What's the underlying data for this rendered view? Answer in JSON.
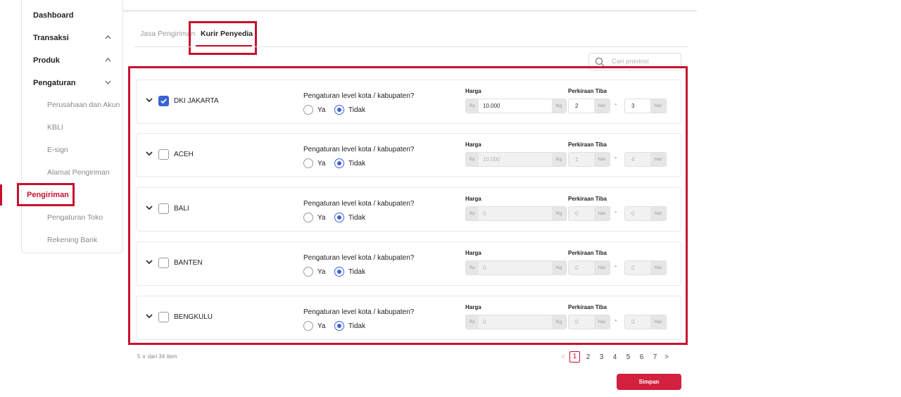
{
  "sidebar": {
    "dashboard": "Dashboard",
    "transaksi": "Transaksi",
    "produk": "Produk",
    "pengaturan": "Pengaturan",
    "sub_items": [
      "Perusahaan dan Akun",
      "KBLI",
      "E-sign",
      "Alamat Pengiriman",
      "Pengiriman",
      "Pengaturan Toko",
      "Rekening Bank"
    ],
    "active_item": "Pengiriman"
  },
  "tabs": [
    "Jasa Pengiriman",
    "Kurir Penyedia"
  ],
  "active_tab": "Kurir Penyedia",
  "search": {
    "placeholder": "Cari provinsi"
  },
  "labels": {
    "question": "Pengaturan level kota / kabupaten?",
    "yes": "Ya",
    "no": "Tidak",
    "price": "Harga",
    "eta": "Perkiraan Tiba",
    "currency_prefix": "Rp",
    "unit_suffix": "/Kg",
    "day_suffix": "Hari"
  },
  "provinces": [
    {
      "name": "DKI JAKARTA",
      "checked": true,
      "city_level": false,
      "price": "10.000",
      "eta_min": "2",
      "eta_max": "3"
    },
    {
      "name": "ACEH",
      "checked": false,
      "city_level": false,
      "price": "10.000",
      "eta_min": "1",
      "eta_max": "4"
    },
    {
      "name": "BALI",
      "checked": false,
      "city_level": false,
      "price": "0",
      "eta_min": "0",
      "eta_max": "0"
    },
    {
      "name": "BANTEN",
      "checked": false,
      "city_level": false,
      "price": "0",
      "eta_min": "0",
      "eta_max": "0"
    },
    {
      "name": "BENGKULU",
      "checked": false,
      "city_level": false,
      "price": "0",
      "eta_min": "0",
      "eta_max": "0"
    }
  ],
  "pagination": {
    "per_page_text": "5 ∨ dari 34 item",
    "pages": [
      "1",
      "2",
      "3",
      "4",
      "5",
      "6",
      "7"
    ],
    "current_page": "1",
    "prev": "<",
    "next": ">"
  },
  "save_label": "Simpan",
  "colors": {
    "accent": "#c8102e",
    "checkbox": "#3b63d6",
    "save": "#d3203f"
  }
}
